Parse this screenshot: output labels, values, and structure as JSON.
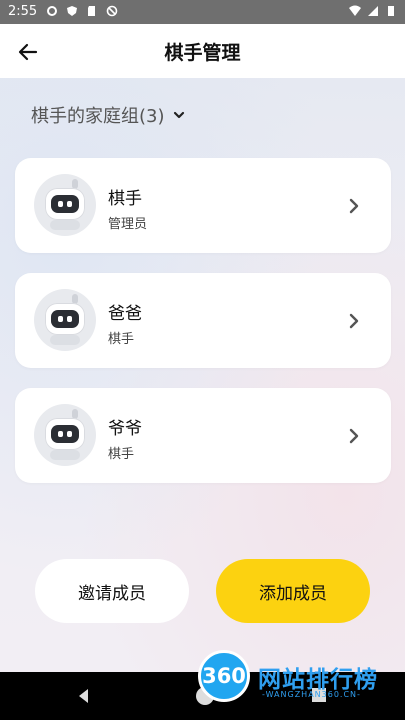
{
  "status_bar": {
    "time": "2:55"
  },
  "header": {
    "title": "棋手管理"
  },
  "group": {
    "label": "棋手的家庭组(3)"
  },
  "members": [
    {
      "name": "棋手",
      "role": "管理员"
    },
    {
      "name": "爸爸",
      "role": "棋手"
    },
    {
      "name": "爷爷",
      "role": "棋手"
    }
  ],
  "actions": {
    "invite_label": "邀请成员",
    "add_label": "添加成员"
  },
  "colors": {
    "accent": "#fcd210",
    "card": "#ffffff"
  },
  "watermark": {
    "logo": "360",
    "text": "网站排行榜",
    "sub": "-WANGZHAN360.CN-"
  }
}
